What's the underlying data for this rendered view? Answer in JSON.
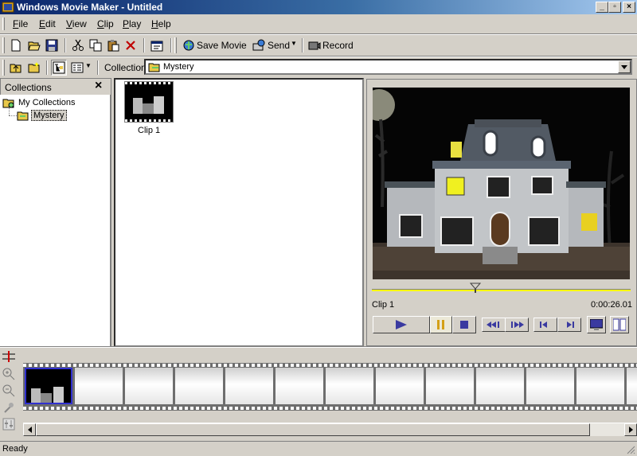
{
  "window": {
    "title": "Windows Movie Maker - Untitled"
  },
  "menu": [
    "File",
    "Edit",
    "View",
    "Clip",
    "Play",
    "Help"
  ],
  "toolbar": {
    "save_movie": "Save Movie",
    "send": "Send",
    "record": "Record"
  },
  "collection_bar": {
    "label": "Collection",
    "value": "Mystery"
  },
  "collections_pane": {
    "header": "Collections",
    "root": "My Collections",
    "child": "Mystery"
  },
  "clips": [
    {
      "name": "Clip 1"
    }
  ],
  "monitor": {
    "clip_name": "Clip 1",
    "time": "0:00:26.01",
    "seek_fraction": 0.4
  },
  "status": {
    "text": "Ready"
  },
  "colors": {
    "title_start": "#0a246a",
    "title_end": "#a6caf0",
    "seek_bar": "#ffff00"
  }
}
